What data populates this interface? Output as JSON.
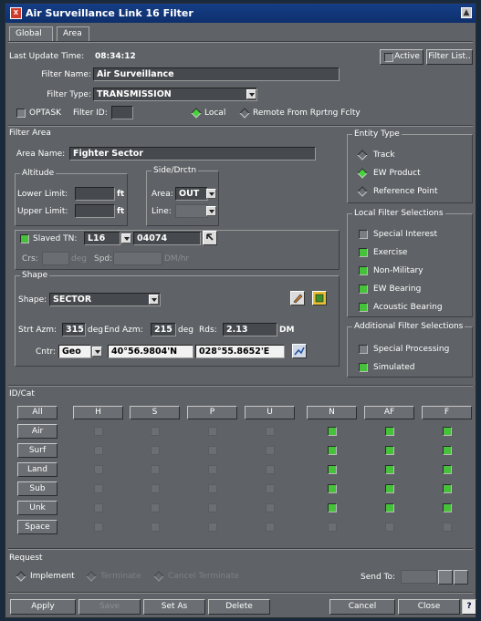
{
  "window": {
    "title": "Air Surveillance Link 16 Filter",
    "app_icon": "X"
  },
  "tabs": [
    "Global",
    "Area"
  ],
  "header": {
    "last_update_label": "Last Update Time:",
    "last_update_value": "08:34:12",
    "active_label": "Active",
    "filter_list_label": "Filter List..",
    "filter_name_label": "Filter Name:",
    "filter_name_value": "Air Surveillance",
    "filter_type_label": "Filter Type:",
    "filter_type_value": "TRANSMISSION",
    "optask_label": "OPTASK",
    "filter_id_label": "Filter ID:",
    "filter_id_value": "",
    "local_label": "Local",
    "remote_label": "Remote From Rprtng Fclty"
  },
  "filter_area": {
    "title": "Filter Area",
    "area_name_label": "Area Name:",
    "area_name_value": "Fighter Sector",
    "altitude": {
      "title": "Altitude",
      "lower_label": "Lower Limit:",
      "lower_value": "",
      "upper_label": "Upper Limit:",
      "upper_value": "",
      "unit": "ft"
    },
    "side": {
      "title": "Side/Drctn",
      "area_label": "Area:",
      "area_value": "OUT",
      "line_label": "Line:",
      "line_value": ""
    },
    "slaved_label": "Slaved TN:",
    "slaved_link": "L16",
    "slaved_tn": "04074",
    "crs_label": "Crs:",
    "crs_unit": "deg",
    "spd_label": "Spd:",
    "spd_unit": "DM/hr"
  },
  "shape": {
    "title": "Shape",
    "shape_label": "Shape:",
    "shape_value": "SECTOR",
    "strt_label": "Strt Azm:",
    "strt_value": "315",
    "end_label": "End Azm:",
    "end_value": "215",
    "deg": "deg",
    "rds_label": "Rds:",
    "rds_value": "2.13",
    "rds_unit": "DM",
    "cntr_label": "Cntr:",
    "cntr_type": "Geo",
    "lat": "40°56.9804'N",
    "lon": "028°55.8652'E"
  },
  "entity_type": {
    "title": "Entity Type",
    "options": [
      "Track",
      "EW Product",
      "Reference Point"
    ],
    "selected": 1
  },
  "local_filter": {
    "title": "Local Filter Selections",
    "items": [
      {
        "label": "Special Interest",
        "on": false
      },
      {
        "label": "Exercise",
        "on": true
      },
      {
        "label": "Non-Military",
        "on": true
      },
      {
        "label": "EW Bearing",
        "on": true
      },
      {
        "label": "Acoustic Bearing",
        "on": true
      }
    ]
  },
  "additional_filter": {
    "title": "Additional Filter Selections",
    "items": [
      {
        "label": "Special Processing",
        "on": false
      },
      {
        "label": "Simulated",
        "on": true
      }
    ]
  },
  "idcat": {
    "title": "ID/Cat",
    "all_label": "All",
    "columns": [
      "H",
      "S",
      "P",
      "U",
      "N",
      "AF",
      "F"
    ],
    "rows": [
      {
        "label": "Air",
        "vals": [
          0,
          0,
          0,
          0,
          1,
          1,
          1
        ]
      },
      {
        "label": "Surf",
        "vals": [
          0,
          0,
          0,
          0,
          1,
          1,
          1
        ]
      },
      {
        "label": "Land",
        "vals": [
          0,
          0,
          0,
          0,
          1,
          1,
          1
        ]
      },
      {
        "label": "Sub",
        "vals": [
          0,
          0,
          0,
          0,
          1,
          1,
          1
        ]
      },
      {
        "label": "Unk",
        "vals": [
          0,
          0,
          0,
          0,
          1,
          1,
          1
        ]
      },
      {
        "label": "Space",
        "vals": [
          0,
          0,
          0,
          0,
          0,
          0,
          0
        ]
      }
    ]
  },
  "request": {
    "title": "Request",
    "options": [
      "Implement",
      "Terminate",
      "Cancel Terminate"
    ],
    "selected": 0,
    "send_to_label": "Send To:"
  },
  "buttons": {
    "apply": "Apply",
    "save": "Save",
    "set_as": "Set As",
    "delete": "Delete",
    "cancel": "Cancel",
    "close": "Close",
    "help": "?"
  }
}
